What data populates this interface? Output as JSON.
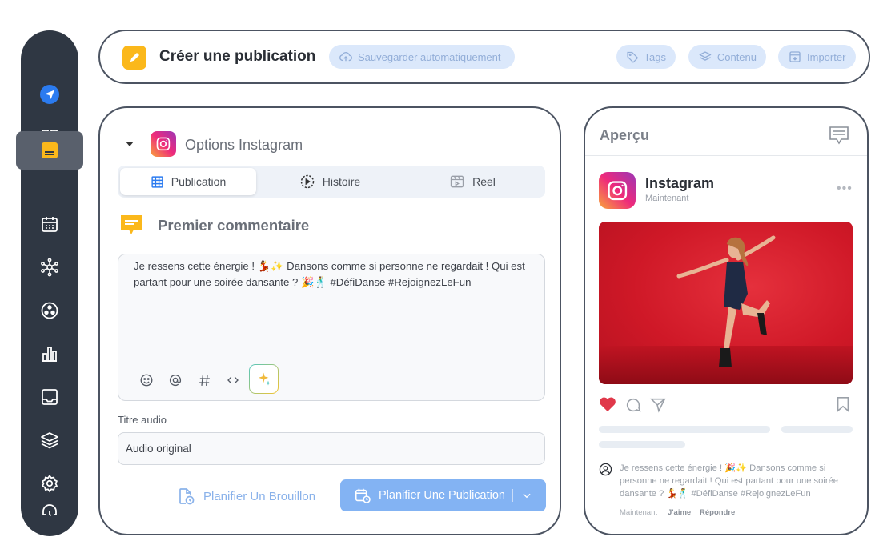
{
  "sidebar": {
    "items": [
      {
        "icon": "send-logo-icon"
      },
      {
        "icon": "dashboard-icon"
      },
      {
        "icon": "compose-icon",
        "active": true
      },
      {
        "icon": "calendar-icon"
      },
      {
        "icon": "network-icon"
      },
      {
        "icon": "connections-icon"
      },
      {
        "icon": "analytics-icon"
      },
      {
        "icon": "inbox-icon"
      },
      {
        "icon": "layers-icon"
      },
      {
        "icon": "settings-icon"
      },
      {
        "icon": "support-icon"
      }
    ]
  },
  "header": {
    "title": "Créer une publication",
    "autosave_label": "Sauvegarder automatiquement",
    "tags_label": "Tags",
    "content_label": "Contenu",
    "import_label": "Importer"
  },
  "main": {
    "options_title": "Options Instagram",
    "tabs": [
      {
        "label": "Publication",
        "active": true
      },
      {
        "label": "Histoire",
        "active": false
      },
      {
        "label": "Reel",
        "active": false
      }
    ],
    "first_comment_title": "Premier commentaire",
    "comment_text": "Je ressens cette énergie ! 💃✨ Dansons comme si personne ne regardait ! Qui est partant pour une soirée dansante ? 🎉🕺 #DéfiDanse #RejoignezLeFun",
    "tools": [
      "emoji-icon",
      "mention-icon",
      "hashtag-icon",
      "code-icon",
      "ai-sparkle-icon"
    ],
    "audio_label": "Titre audio",
    "audio_value": "Audio original",
    "draft_button": "Planifier Un Brouillon",
    "publish_button": "Planifier Une Publication"
  },
  "preview": {
    "title": "Aperçu",
    "account_name": "Instagram",
    "timestamp": "Maintenant",
    "caption": "Je ressens cette énergie ! 🎉✨ Dansons comme si personne ne regardait ! Qui est partant pour une soirée dansante ? 💃🕺 #DéfiDanse #RejoignezLeFun",
    "meta_time": "Maintenant",
    "like_label": "J'aime",
    "reply_label": "Répondre"
  },
  "colors": {
    "sidebar_bg": "#2f3743",
    "accent_yellow": "#fbb81b",
    "primary_blue": "#83b3f3",
    "pill_bg": "#dbe8fb",
    "image_red": "#d41c2c"
  }
}
